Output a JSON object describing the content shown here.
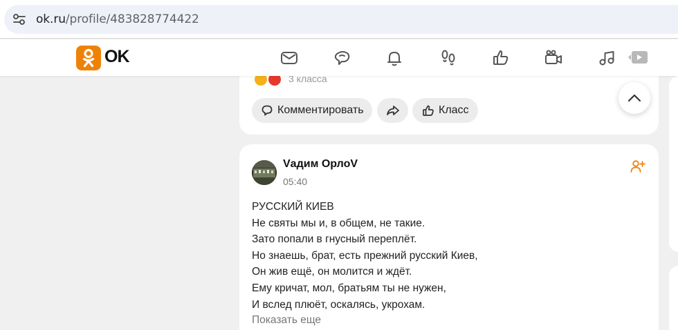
{
  "browser": {
    "url_domain": "ok.ru",
    "url_path": "/profile/483828774422"
  },
  "ok_nav": {
    "logo_text": "OK",
    "icons": [
      "messages-icon",
      "discussions-icon",
      "notifications-icon",
      "guests-icon",
      "likes-icon",
      "video-icon",
      "music-icon",
      "live-video-icon"
    ]
  },
  "top_post": {
    "klass_count": "3 класса",
    "comment_label": "Комментировать",
    "klass_label": "Класс"
  },
  "post": {
    "author": "Vадим ОрлоV",
    "time": "05:40",
    "lines": [
      "РУССКИЙ КИЕВ",
      "Не святы мы и, в общем, не такие.",
      "Зато попали в гнусный переплёт.",
      "Но знаешь, брат, есть прежний русский Киев,",
      "Он жив ещё, он молится и ждёт.",
      "Ему кричат, мол, братьям ты не нужен,",
      "И вслед плюёт, оскалясь, укрохам."
    ],
    "show_more": "Показать еще"
  },
  "colors": {
    "brand_orange": "#ee8208",
    "page_bg": "#f0f0f0",
    "pill_bg": "#ececec"
  }
}
